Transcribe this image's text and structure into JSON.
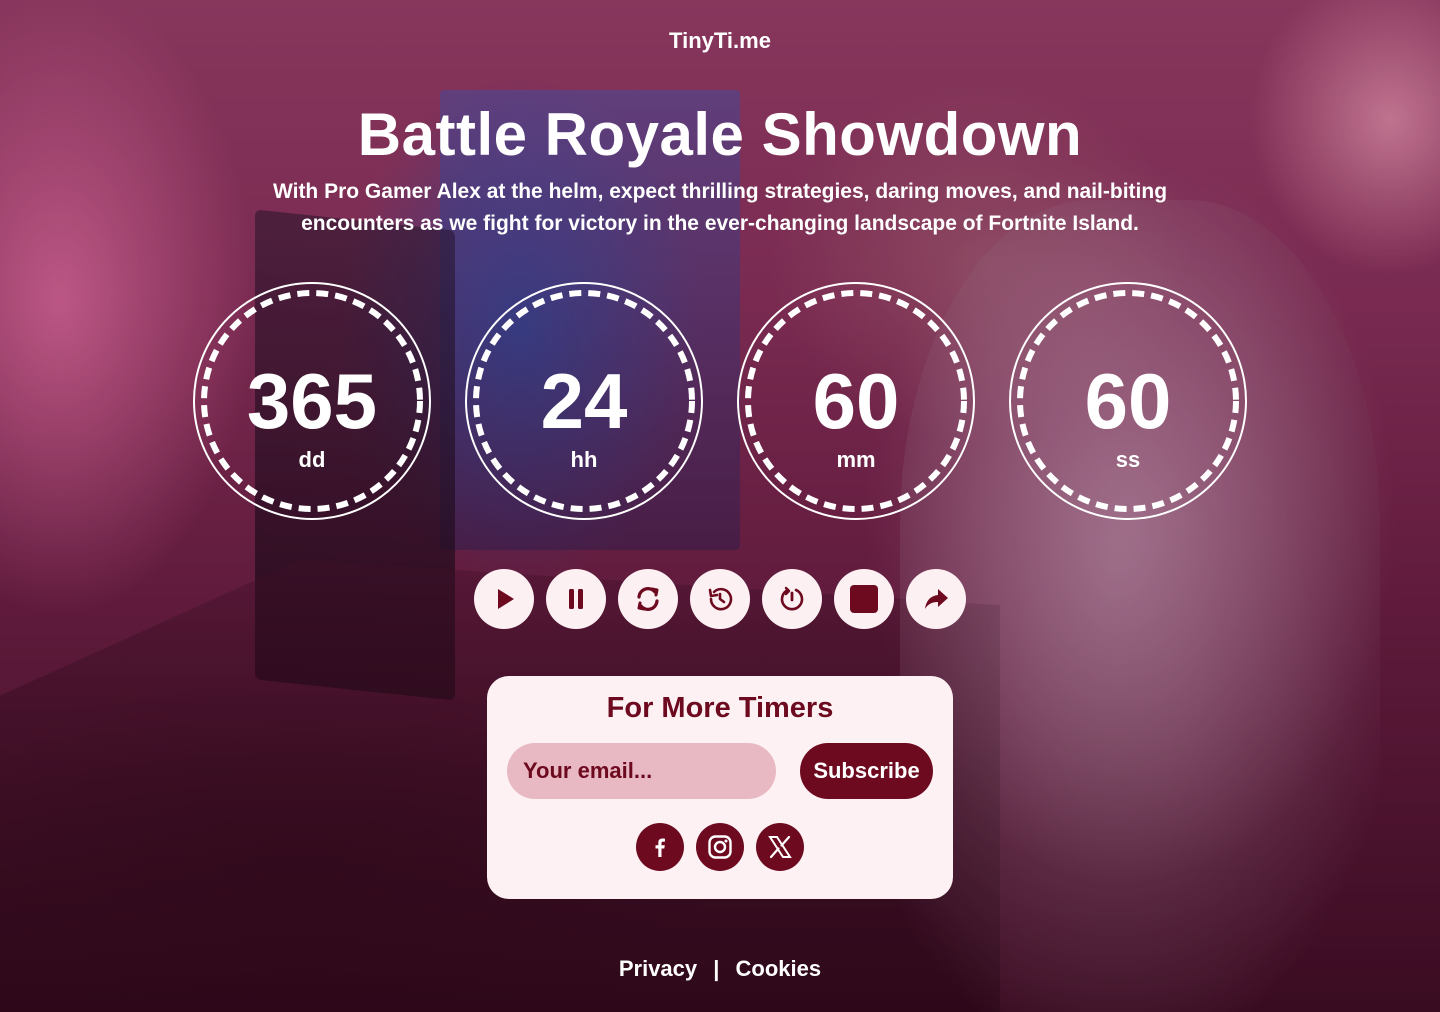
{
  "brand": "TinyTi.me",
  "title": "Battle Royale Showdown",
  "description": "With Pro Gamer Alex at the helm, expect thrilling strategies, daring moves, and nail-biting encounters as we fight for victory in the ever-changing landscape of Fortnite Island.",
  "countdown": {
    "days": {
      "value": "365",
      "unit": "dd"
    },
    "hours": {
      "value": "24",
      "unit": "hh"
    },
    "minutes": {
      "value": "60",
      "unit": "mm"
    },
    "seconds": {
      "value": "60",
      "unit": "ss"
    }
  },
  "controls": [
    {
      "name": "play-icon"
    },
    {
      "name": "pause-icon"
    },
    {
      "name": "refresh-icon"
    },
    {
      "name": "history-icon"
    },
    {
      "name": "timer-reset-icon"
    },
    {
      "name": "stop-icon"
    },
    {
      "name": "share-icon"
    }
  ],
  "subscribe": {
    "heading": "For More Timers",
    "email_placeholder": "Your email...",
    "button_label": "Subscribe",
    "social": [
      "facebook-icon",
      "instagram-icon",
      "x-icon"
    ]
  },
  "footer": {
    "privacy": "Privacy",
    "separator": "|",
    "cookies": "Cookies"
  },
  "colors": {
    "accent": "#6d0a1f",
    "card_bg": "#fdf1f3",
    "input_bg": "#e8b9c2"
  }
}
